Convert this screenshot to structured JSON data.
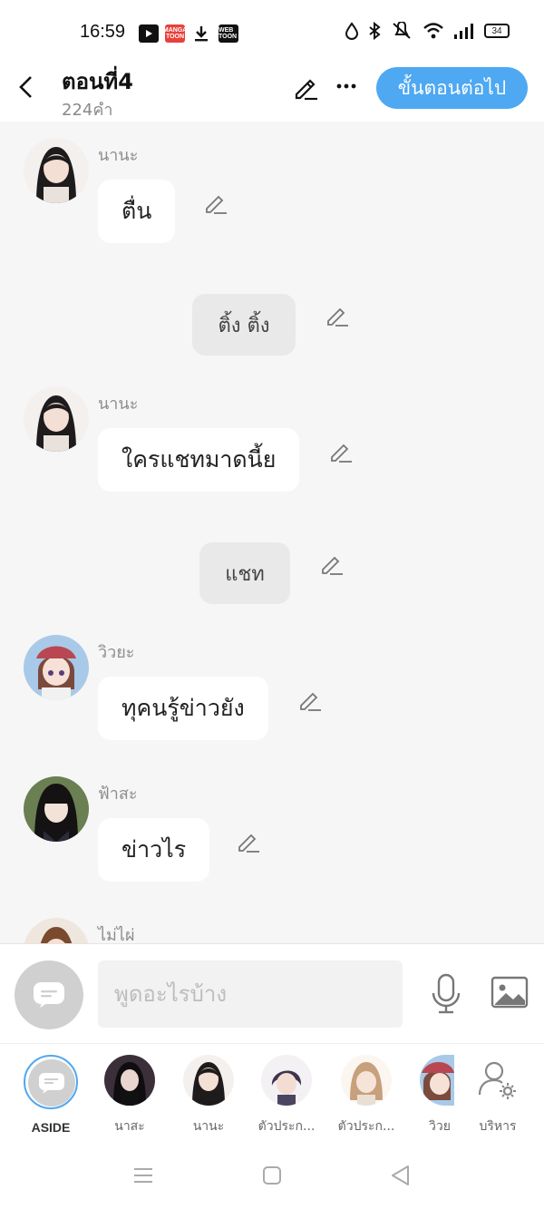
{
  "status_bar": {
    "time": "16:59",
    "apps": [
      "youtube-icon",
      "mangatoon-icon",
      "download-icon",
      "webtoon-icon"
    ],
    "app_labels": {
      "manga": "MANGA TOON",
      "webtoon": "WEB TOON"
    },
    "right_icons": [
      "drop-icon",
      "bluetooth-icon",
      "mute-icon",
      "wifi-icon",
      "signal-icon"
    ],
    "battery": "34"
  },
  "header": {
    "title": "ตอนที่4",
    "subtitle": "224คำ",
    "next_button": "ขั้นตอนต่อไป"
  },
  "messages": [
    {
      "type": "character",
      "name": "นานะ",
      "text": "ตื่น"
    },
    {
      "type": "narration",
      "text": "ติ้ง ติ้ง"
    },
    {
      "type": "character",
      "name": "นานะ",
      "text": "ใครแชทมาดนี้ย"
    },
    {
      "type": "narration",
      "text": "แชท"
    },
    {
      "type": "character",
      "name": "วิวยะ",
      "text": "ทุคนรู้ข่าวยัง"
    },
    {
      "type": "character",
      "name": "ฟ้าสะ",
      "text": "ข่าวไร"
    },
    {
      "type": "character",
      "name": "ไม่ไผ่",
      "text": ""
    }
  ],
  "input": {
    "placeholder": "พูดอะไรบ้าง",
    "value": ""
  },
  "characters": [
    {
      "label": "ASIDE",
      "active": true
    },
    {
      "label": "นาสะ"
    },
    {
      "label": "นานะ"
    },
    {
      "label": "ตัวประก..."
    },
    {
      "label": "ตัวประก..."
    },
    {
      "label": "วิวย"
    },
    {
      "label": "บริหาร"
    }
  ],
  "colors": {
    "accent": "#4ea8f2",
    "background": "#f6f6f6",
    "bubble": "#ffffff",
    "narration_bubble": "#e9e9e9"
  }
}
